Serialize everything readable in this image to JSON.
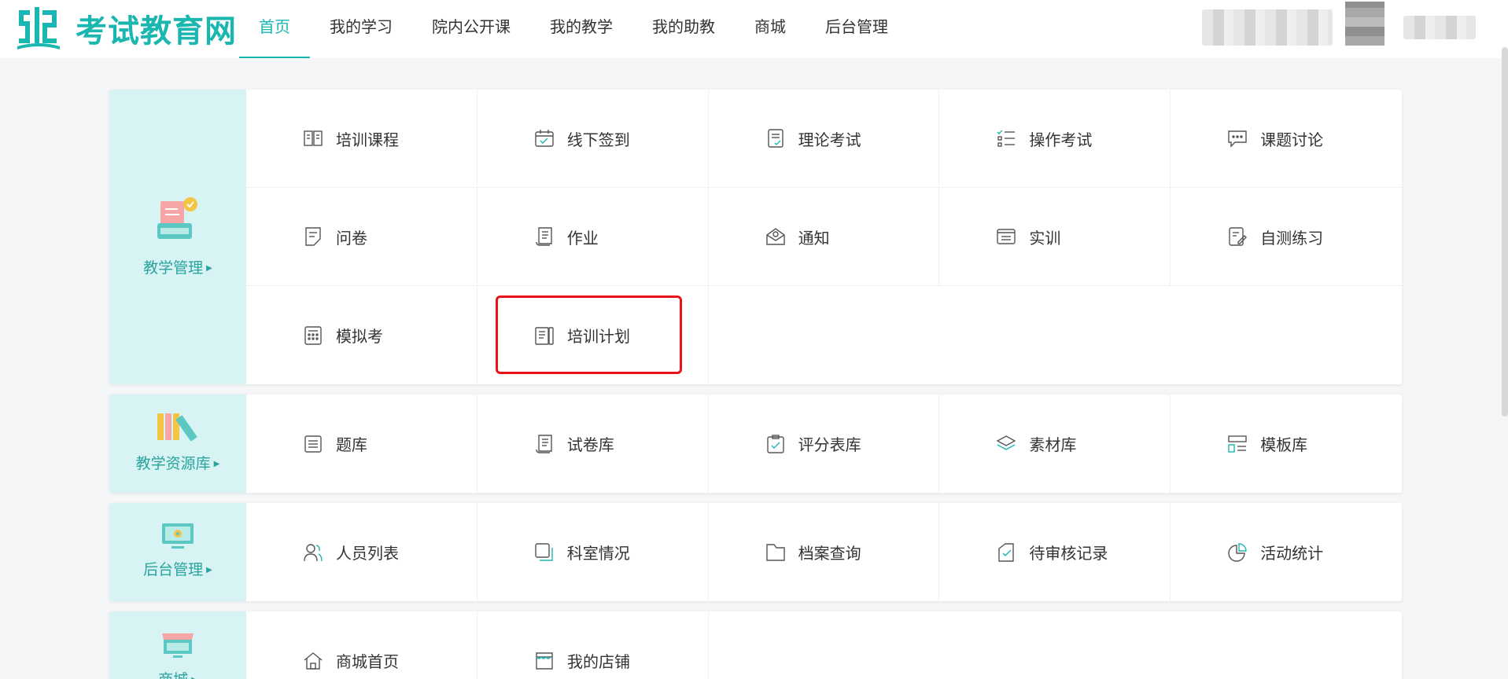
{
  "header": {
    "logo_text": "考试教育网",
    "nav": [
      "首页",
      "我的学习",
      "院内公开课",
      "我的教学",
      "我的助教",
      "商城",
      "后台管理"
    ],
    "active_nav": 0
  },
  "colors": {
    "accent": "#1ab6b0",
    "side_bg": "#d7f3f3",
    "highlight": "#e8131a"
  },
  "sections": [
    {
      "title": "教学管理",
      "icon": "teaching-management-icon",
      "rows": [
        [
          {
            "label": "培训课程",
            "icon": "book-open-icon"
          },
          {
            "label": "线下签到",
            "icon": "calendar-check-icon"
          },
          {
            "label": "理论考试",
            "icon": "document-check-icon"
          },
          {
            "label": "操作考试",
            "icon": "checklist-icon"
          },
          {
            "label": "课题讨论",
            "icon": "chat-bubble-icon"
          }
        ],
        [
          {
            "label": "问卷",
            "icon": "questionnaire-icon"
          },
          {
            "label": "作业",
            "icon": "scroll-icon"
          },
          {
            "label": "通知",
            "icon": "envelope-open-icon"
          },
          {
            "label": "实训",
            "icon": "list-box-icon"
          },
          {
            "label": "自测练习",
            "icon": "edit-document-icon"
          }
        ],
        [
          {
            "label": "模拟考",
            "icon": "calculator-doc-icon"
          },
          {
            "label": "培训计划",
            "icon": "plan-book-icon"
          }
        ]
      ]
    },
    {
      "title": "教学资源库",
      "icon": "books-icon",
      "rows": [
        [
          {
            "label": "题库",
            "icon": "list-doc-icon"
          },
          {
            "label": "试卷库",
            "icon": "paper-scroll-icon"
          },
          {
            "label": "评分表库",
            "icon": "clipboard-check-icon"
          },
          {
            "label": "素材库",
            "icon": "layers-icon"
          },
          {
            "label": "模板库",
            "icon": "template-icon"
          }
        ]
      ]
    },
    {
      "title": "后台管理",
      "icon": "monitor-gear-icon",
      "rows": [
        [
          {
            "label": "人员列表",
            "icon": "users-icon"
          },
          {
            "label": "科室情况",
            "icon": "copy-square-icon"
          },
          {
            "label": "档案查询",
            "icon": "folder-icon"
          },
          {
            "label": "待审核记录",
            "icon": "pending-check-icon"
          },
          {
            "label": "活动统计",
            "icon": "pie-chart-icon"
          }
        ]
      ]
    },
    {
      "title": "商城",
      "icon": "shop-stall-icon",
      "rows": [
        [
          {
            "label": "商城首页",
            "icon": "home-icon"
          },
          {
            "label": "我的店铺",
            "icon": "store-icon"
          }
        ]
      ]
    }
  ]
}
